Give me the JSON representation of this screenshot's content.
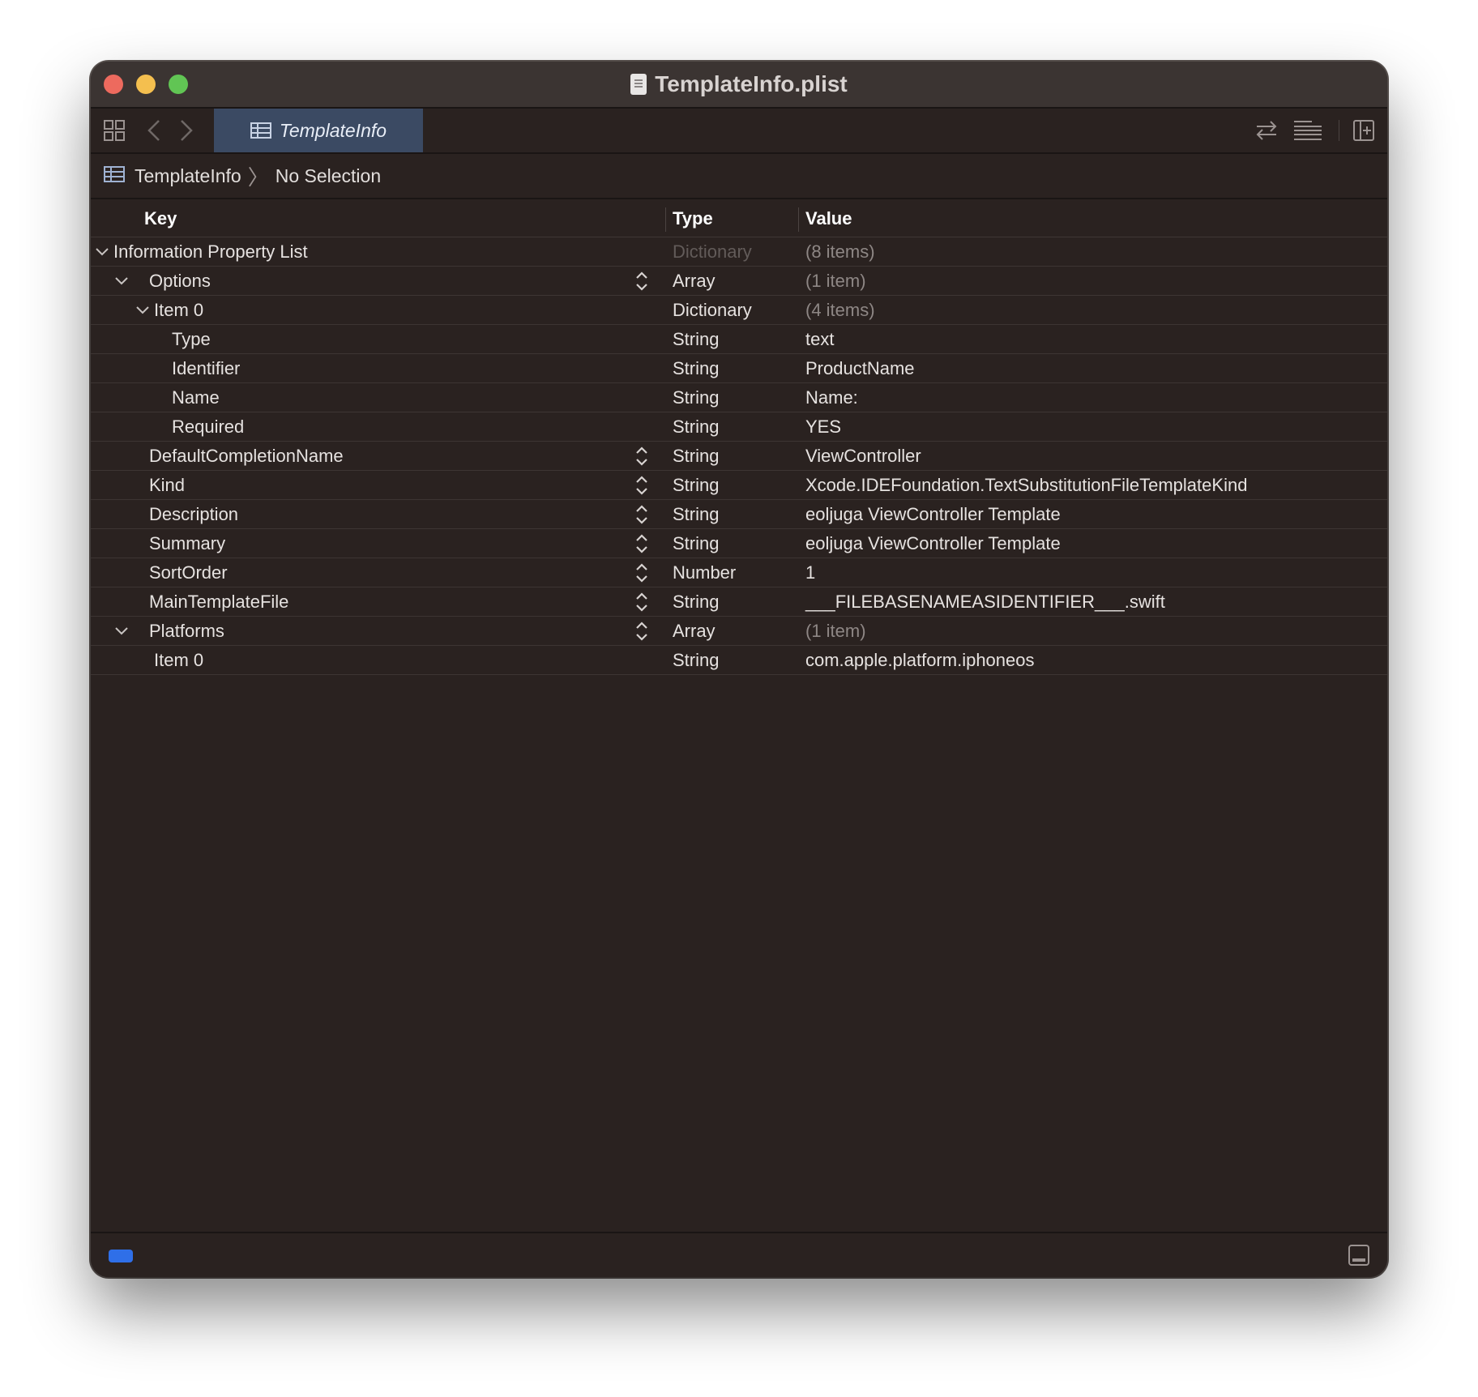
{
  "window": {
    "title": "TemplateInfo.plist"
  },
  "toolbar": {
    "tab_label": "TemplateInfo",
    "icons": [
      "grid-icon",
      "back-icon",
      "forward-icon",
      "swap-icon",
      "lines-icon",
      "add-editor-icon"
    ]
  },
  "breadcrumb": {
    "root": "TemplateInfo",
    "selection": "No Selection"
  },
  "columns": {
    "key": "Key",
    "type": "Type",
    "value": "Value"
  },
  "rows": [
    {
      "key": "Information Property List",
      "type": "Dictionary",
      "value": "(8 items)",
      "level": 0,
      "expanded": true,
      "stepper": false,
      "type_dim": true,
      "value_muted": true
    },
    {
      "key": "Options",
      "type": "Array",
      "value": "(1 item)",
      "level": 1,
      "expanded": true,
      "stepper": true,
      "value_muted": true
    },
    {
      "key": "Item 0",
      "type": "Dictionary",
      "value": "(4 items)",
      "level": 2,
      "expanded": true,
      "stepper": false,
      "value_muted": true
    },
    {
      "key": "Type",
      "type": "String",
      "value": "text",
      "level": 3,
      "stepper": false
    },
    {
      "key": "Identifier",
      "type": "String",
      "value": "ProductName",
      "level": 3,
      "stepper": false
    },
    {
      "key": "Name",
      "type": "String",
      "value": "Name:",
      "level": 3,
      "stepper": false
    },
    {
      "key": "Required",
      "type": "String",
      "value": "YES",
      "level": 3,
      "stepper": false
    },
    {
      "key": "DefaultCompletionName",
      "type": "String",
      "value": "ViewController",
      "level": 1,
      "stepper": true
    },
    {
      "key": "Kind",
      "type": "String",
      "value": "Xcode.IDEFoundation.TextSubstitutionFileTemplateKind",
      "level": 1,
      "stepper": true
    },
    {
      "key": "Description",
      "type": "String",
      "value": "eoljuga ViewController Template",
      "level": 1,
      "stepper": true
    },
    {
      "key": "Summary",
      "type": "String",
      "value": "eoljuga ViewController Template",
      "level": 1,
      "stepper": true
    },
    {
      "key": "SortOrder",
      "type": "Number",
      "value": "1",
      "level": 1,
      "stepper": true
    },
    {
      "key": "MainTemplateFile",
      "type": "String",
      "value": "___FILEBASENAMEASIDENTIFIER___.swift",
      "level": 1,
      "stepper": true
    },
    {
      "key": "Platforms",
      "type": "Array",
      "value": "(1 item)",
      "level": 1,
      "expanded": true,
      "stepper": true,
      "value_muted": true
    },
    {
      "key": "Item 0",
      "type": "String",
      "value": "com.apple.platform.iphoneos",
      "level": 2,
      "stepper": false
    }
  ],
  "colors": {
    "tab_active": "#3b4a63",
    "status_indicator": "#2f6fe8"
  }
}
